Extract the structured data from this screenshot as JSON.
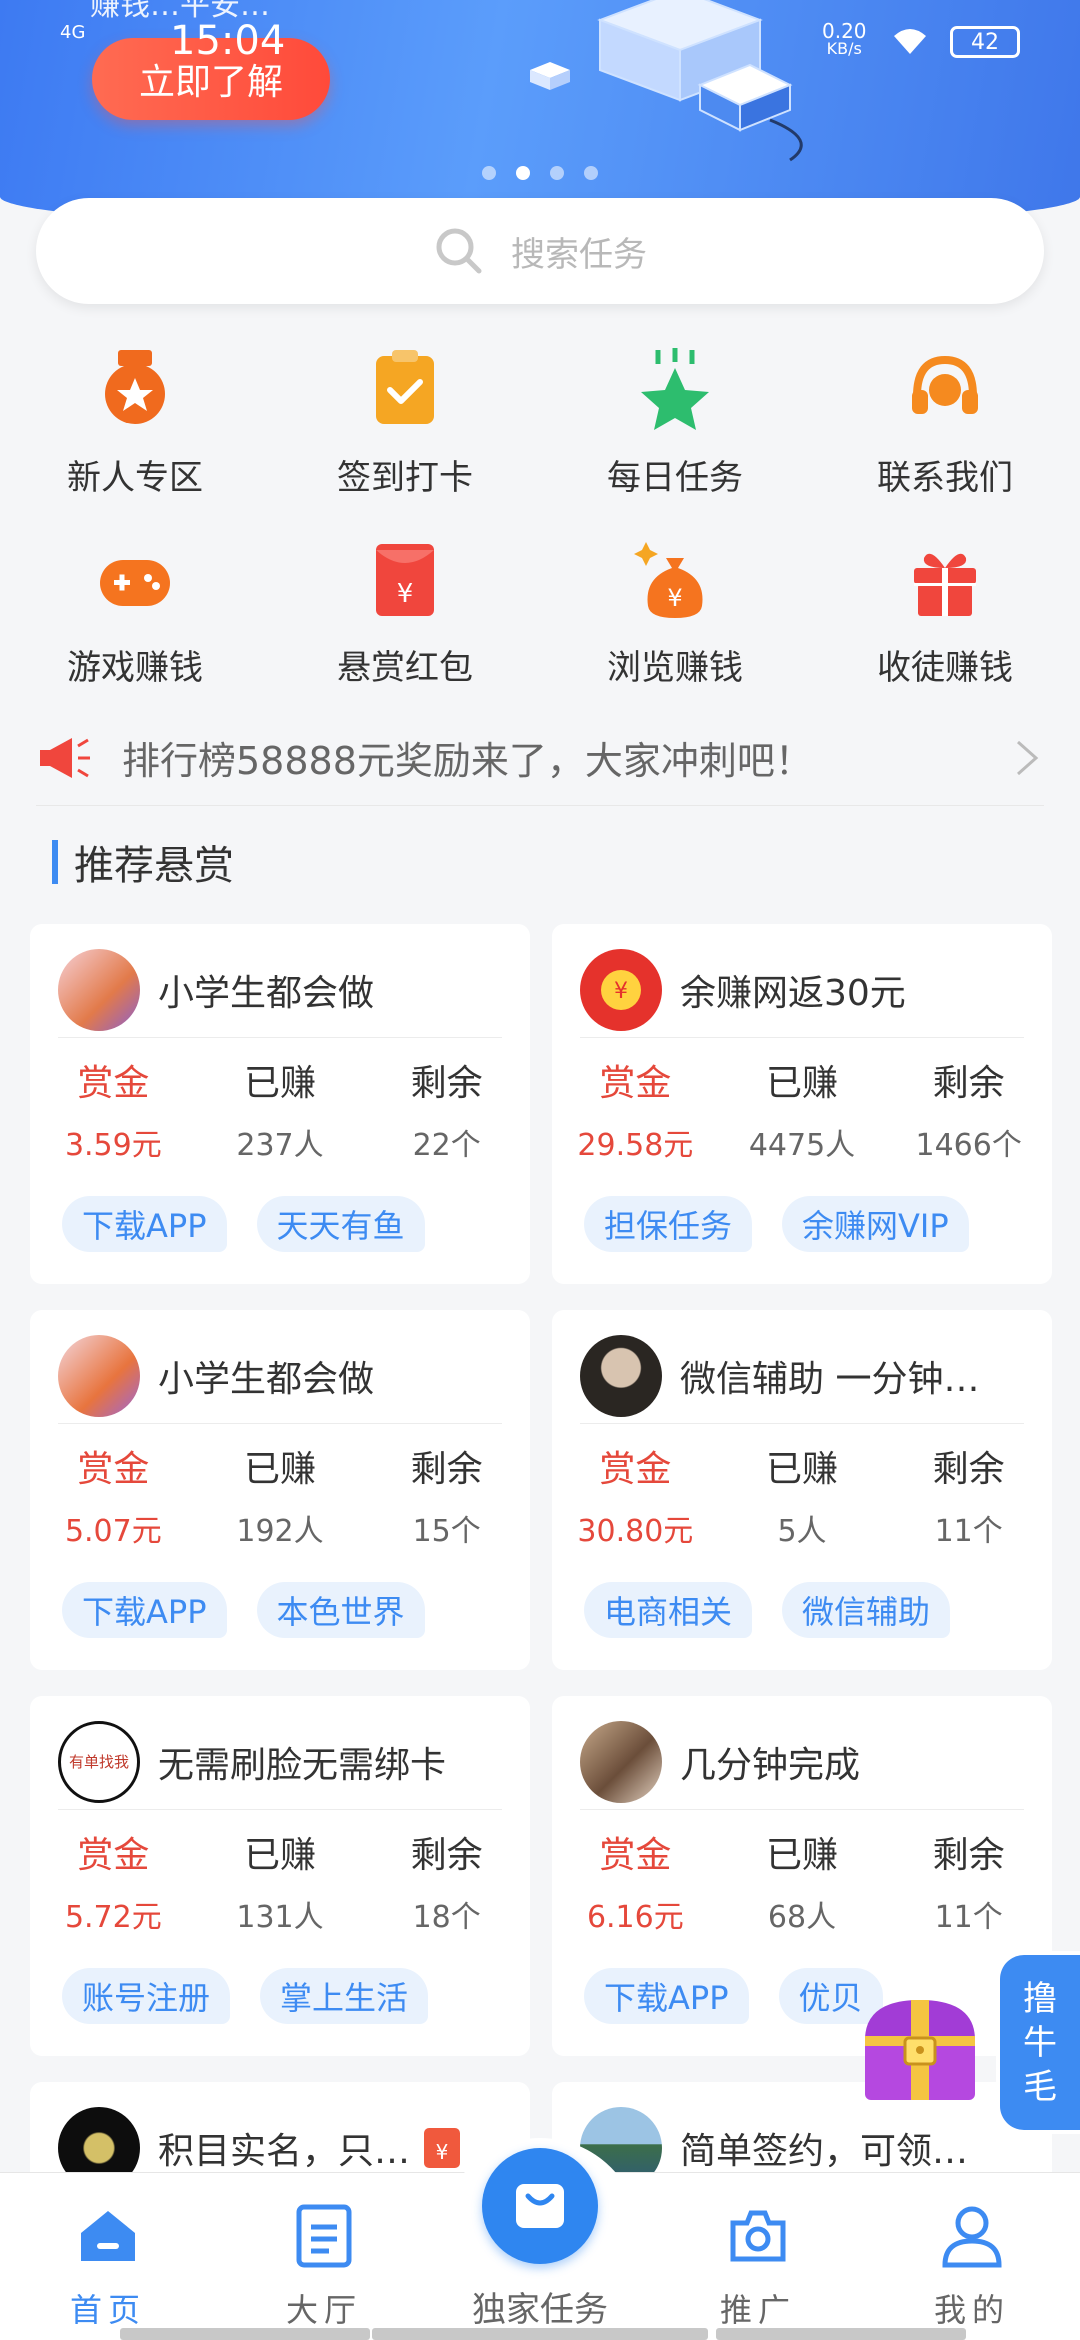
{
  "status_bar": {
    "network": "4G",
    "time": "15:04",
    "speed": "0.20",
    "speed_unit": "KB/s",
    "battery": "42"
  },
  "banner": {
    "top_text": "赚钱…平安…",
    "cta": "立即了解",
    "dots": 4,
    "active_dot": 1
  },
  "search": {
    "placeholder": "搜索任务"
  },
  "grid": [
    {
      "label": "新人专区",
      "icon": "medal-icon",
      "color": "#f06a1e"
    },
    {
      "label": "签到打卡",
      "icon": "clipboard-check-icon",
      "color": "#f5a623"
    },
    {
      "label": "每日任务",
      "icon": "star-icon",
      "color": "#2dbd6e"
    },
    {
      "label": "联系我们",
      "icon": "headset-icon",
      "color": "#f58a1f"
    },
    {
      "label": "游戏赚钱",
      "icon": "gamepad-icon",
      "color": "#f5741f"
    },
    {
      "label": "悬赏红包",
      "icon": "red-envelope-icon",
      "color": "#f0463d"
    },
    {
      "label": "浏览赚钱",
      "icon": "money-bag-icon",
      "color": "#f5741f"
    },
    {
      "label": "收徒赚钱",
      "icon": "gift-icon",
      "color": "#f0463d"
    }
  ],
  "notice": {
    "text": "排行榜58888元奖励来了，大家冲刺吧！"
  },
  "section": {
    "title": "推荐悬赏"
  },
  "stat_labels": {
    "reward": "赏金",
    "earned": "已赚",
    "remaining": "剩余"
  },
  "cards": [
    {
      "title": "小学生都会做",
      "reward": "3.59元",
      "earned": "237人",
      "remaining": "22个",
      "tags": [
        "下载APP",
        "天天有鱼"
      ],
      "avatar": "photo-avatar"
    },
    {
      "title": "余赚网返30元",
      "reward": "29.58元",
      "earned": "4475人",
      "remaining": "1466个",
      "tags": [
        "担保任务",
        "余赚网VIP"
      ],
      "avatar": "red-envelope-avatar"
    },
    {
      "title": "小学生都会做",
      "reward": "5.07元",
      "earned": "192人",
      "remaining": "15个",
      "tags": [
        "下载APP",
        "本色世界"
      ],
      "avatar": "photo-avatar"
    },
    {
      "title": "微信辅助 一分钟…",
      "reward": "30.80元",
      "earned": "5人",
      "remaining": "11个",
      "tags": [
        "电商相关",
        "微信辅助"
      ],
      "avatar": "photo-avatar"
    },
    {
      "title": "无需刷脸无需绑卡",
      "reward": "5.72元",
      "earned": "131人",
      "remaining": "18个",
      "tags": [
        "账号注册",
        "掌上生活"
      ],
      "avatar": "text-avatar",
      "avatar_text": "有单找我"
    },
    {
      "title": "几分钟完成",
      "reward": "6.16元",
      "earned": "68人",
      "remaining": "11个",
      "tags": [
        "下载APP",
        "优贝"
      ],
      "avatar": "photo-avatar"
    },
    {
      "title": "积目实名，只…",
      "avatar": "photo-avatar"
    },
    {
      "title": "简单签约，可领…",
      "avatar": "photo-avatar"
    }
  ],
  "float_side": {
    "text": [
      "撸",
      "牛",
      "毛"
    ]
  },
  "tabbar": [
    {
      "label": "首页",
      "icon": "home-icon",
      "active": true
    },
    {
      "label": "大厅",
      "icon": "document-icon",
      "active": false
    },
    {
      "label": "独家任务",
      "icon": "shopping-bag-icon",
      "active": false
    },
    {
      "label": "推广",
      "icon": "share-scan-icon",
      "active": false
    },
    {
      "label": "我的",
      "icon": "user-icon",
      "active": false
    }
  ],
  "colors": {
    "primary": "#3d8bf2",
    "red": "#e5483b"
  }
}
